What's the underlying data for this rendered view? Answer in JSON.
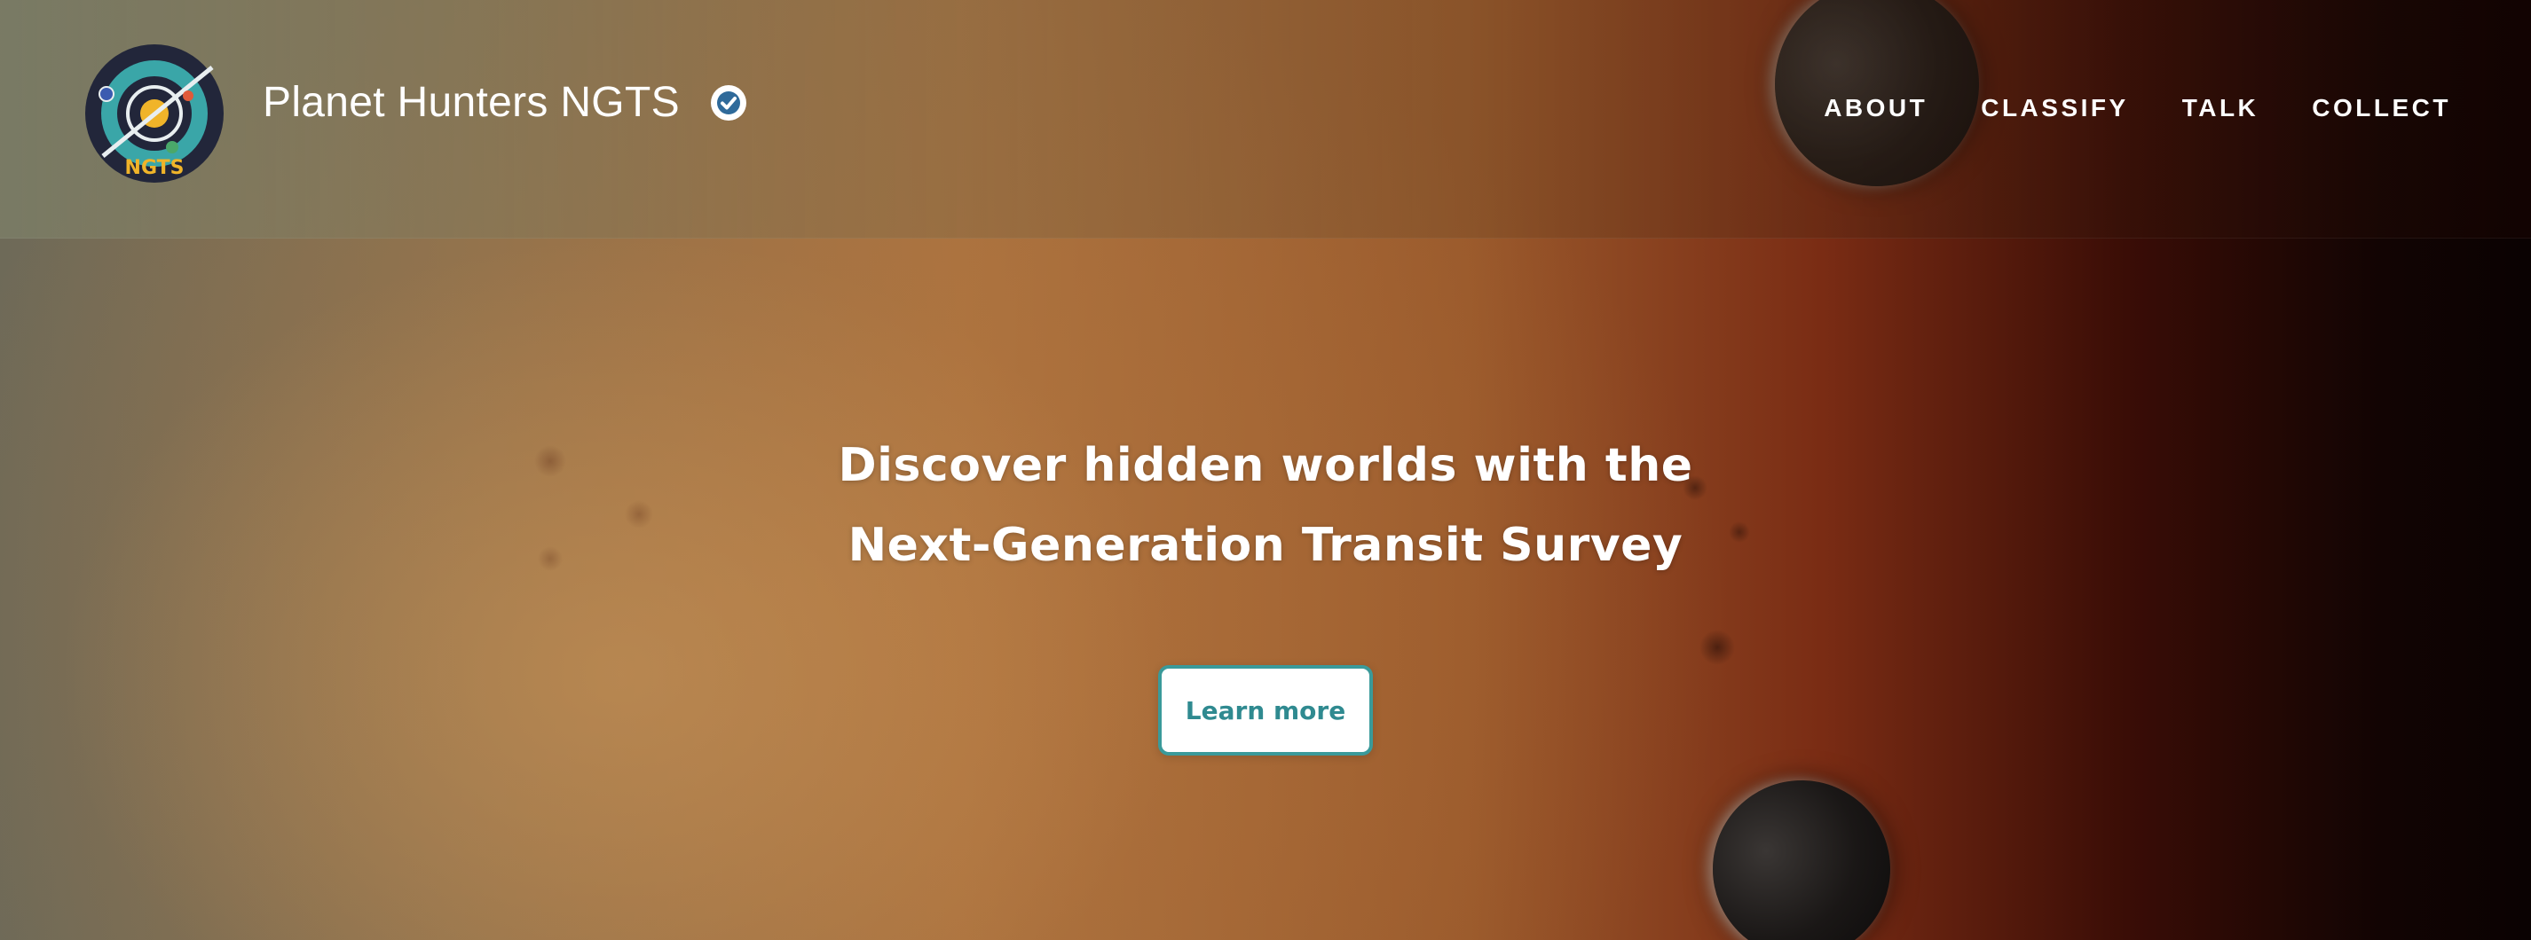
{
  "header": {
    "project_name": "Planet Hunters NGTS",
    "logo_text": "NGTS",
    "verified_icon": "verified-check-icon",
    "nav": [
      {
        "label": "ABOUT"
      },
      {
        "label": "CLASSIFY"
      },
      {
        "label": "TALK"
      },
      {
        "label": "COLLECT"
      }
    ]
  },
  "hero": {
    "headline_line1": "Discover hidden worlds with the",
    "headline_line2": "Next-Generation Transit Survey",
    "cta_label": "Learn more"
  },
  "colors": {
    "accent": "#3a9a9a",
    "cta_text": "#2f8a90",
    "logo_ring": "#3aa6a8",
    "logo_sun": "#f0b429"
  }
}
